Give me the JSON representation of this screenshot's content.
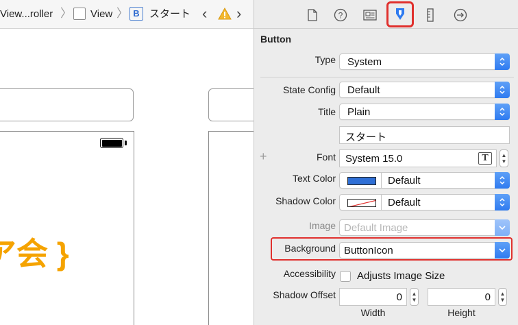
{
  "jumpbar": {
    "items": [
      "View...roller",
      "View",
      "スタート"
    ],
    "b_badge": "B"
  },
  "canvas": {
    "big_title": "ア会 }"
  },
  "inspector": {
    "tabs": [
      "file-inspector",
      "quick-help-inspector",
      "identity-inspector",
      "attributes-inspector",
      "size-inspector",
      "connections-inspector"
    ],
    "active_tab": "attributes-inspector",
    "section_title": "Button",
    "type": {
      "label": "Type",
      "value": "System"
    },
    "state_config": {
      "label": "State Config",
      "value": "Default"
    },
    "title_row": {
      "label": "Title",
      "value": "Plain"
    },
    "title_text": "スタート",
    "font": {
      "label": "Font",
      "value": "System 15.0",
      "button": "T"
    },
    "text_color": {
      "label": "Text Color",
      "value": "Default",
      "swatch": "#2f6fd6"
    },
    "shadow_color": {
      "label": "Shadow Color",
      "value": "Default"
    },
    "image": {
      "label": "Image",
      "placeholder": "Default Image"
    },
    "background": {
      "label": "Background",
      "value": "ButtonIcon"
    },
    "accessibility": {
      "label": "Accessibility",
      "checkbox": "Adjusts Image Size",
      "checked": false
    },
    "shadow_offset": {
      "label": "Shadow Offset",
      "width": "0",
      "height": "0",
      "width_label": "Width",
      "height_label": "Height"
    }
  },
  "colors": {
    "highlight": "#e0302d",
    "accent_blue": "#2f7bf0",
    "title_orange": "#f5a300"
  }
}
